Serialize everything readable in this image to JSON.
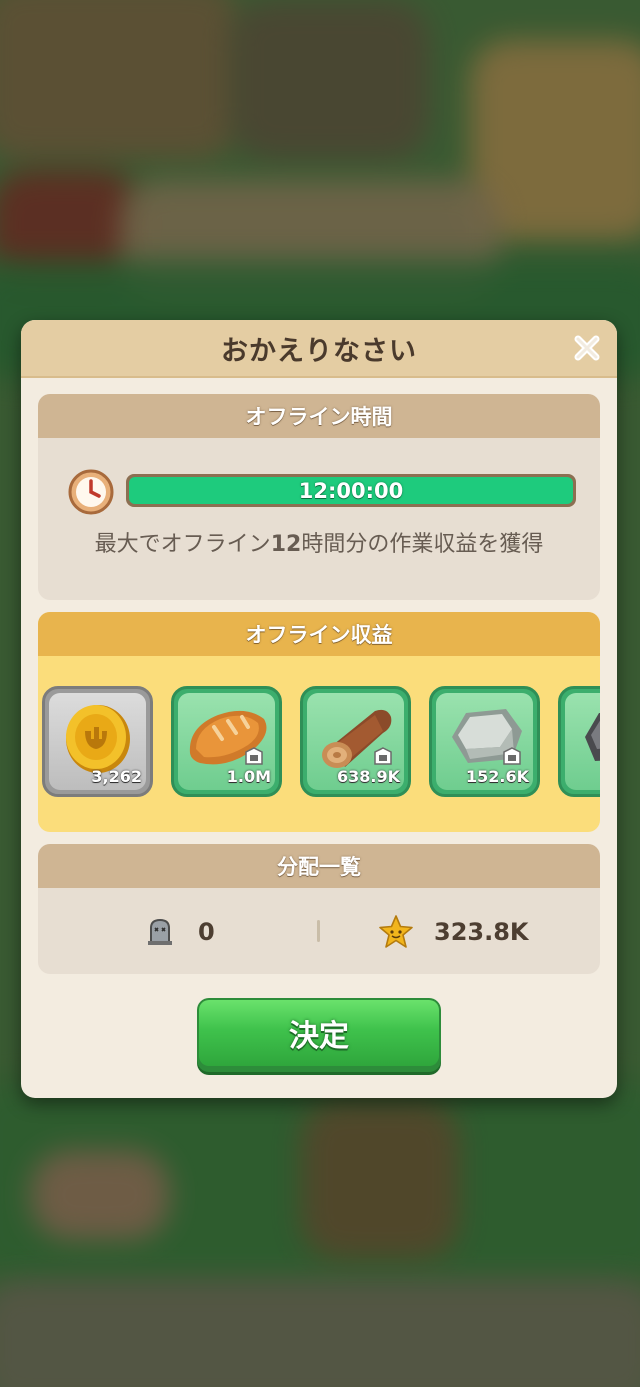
{
  "dialog": {
    "title": "おかえりなさい",
    "close_icon": "close-icon"
  },
  "offline_time": {
    "header": "オフライン時間",
    "clock_icon": "clock-icon",
    "progress_label": "12:00:00",
    "progress_fraction": 1.0,
    "desc_pre": "最大でオフライン",
    "desc_num": "12",
    "desc_post": "時間分の作業収益を獲得"
  },
  "offline_income": {
    "header": "オフライン収益",
    "items": [
      {
        "icon": "gold-coin-icon",
        "qty": "3,262",
        "locked": false
      },
      {
        "icon": "bread-icon",
        "qty": "1.0M",
        "locked": true
      },
      {
        "icon": "log-icon",
        "qty": "638.9K",
        "locked": true
      },
      {
        "icon": "stone-icon",
        "qty": "152.6K",
        "locked": true
      },
      {
        "icon": "iron-ore-icon",
        "qty": "",
        "locked": true
      }
    ]
  },
  "distribution": {
    "header": "分配一覧",
    "dead_icon": "gravestone-icon",
    "dead_count": "0",
    "star_icon": "star-icon",
    "star_value": "323.8K"
  },
  "confirm": {
    "label": "決定"
  },
  "colors": {
    "progress": "#1ecb7d",
    "confirm_green": "#3fc24c",
    "income_bg": "#fbdd7b",
    "header_tan": "#e4cda3"
  }
}
